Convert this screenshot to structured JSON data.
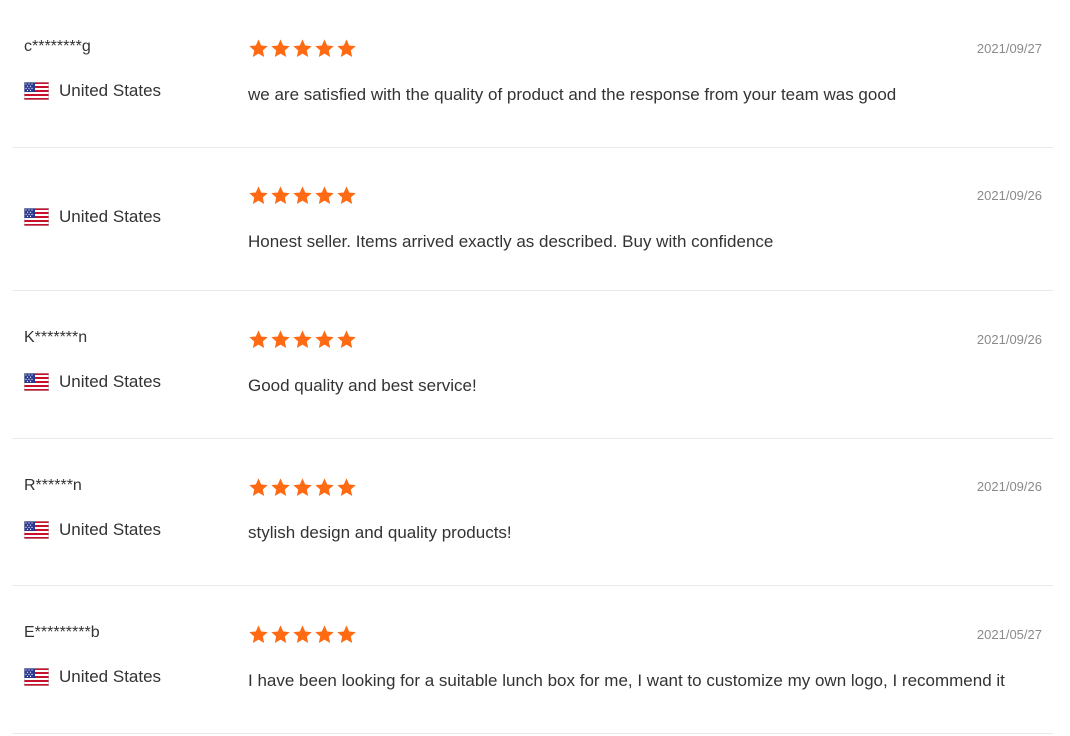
{
  "colors": {
    "star": "#ff6a13",
    "divider": "#ebebeb",
    "date": "#8a8a8a",
    "text": "#333333"
  },
  "rating_icon": "star-icon",
  "flag_icon": "us-flag-icon",
  "reviews": [
    {
      "username": "c********g",
      "country": "United States",
      "rating": 5,
      "date": "2021/09/27",
      "comment": "we are satisfied with the quality of product and the response from your team was good"
    },
    {
      "username": "",
      "country": "United States",
      "rating": 5,
      "date": "2021/09/26",
      "comment": "Honest seller. Items arrived exactly as described. Buy with confidence"
    },
    {
      "username": "K*******n",
      "country": "United States",
      "rating": 5,
      "date": "2021/09/26",
      "comment": "Good quality and best service!"
    },
    {
      "username": "R******n",
      "country": "United States",
      "rating": 5,
      "date": "2021/09/26",
      "comment": "stylish design and quality products!"
    },
    {
      "username": "E*********b",
      "country": "United States",
      "rating": 5,
      "date": "2021/05/27",
      "comment": "I have been looking for a suitable lunch box for me, I want to customize my own logo, I recommend it"
    }
  ]
}
